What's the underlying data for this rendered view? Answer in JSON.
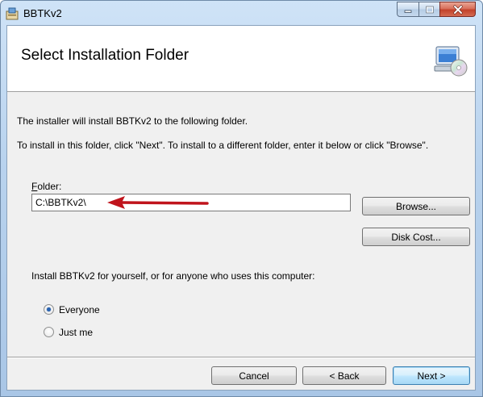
{
  "window": {
    "title": "BBTKv2",
    "controls": {
      "minimize": "minimize",
      "maximize": "maximize",
      "close": "close"
    }
  },
  "banner": {
    "title": "Select Installation Folder",
    "icon": "computer-cd-icon"
  },
  "body": {
    "line1": "The installer will install BBTKv2 to the following folder.",
    "line2": "To install in this folder, click \"Next\". To install to a different folder, enter it below or click \"Browse\"."
  },
  "folder": {
    "label_underlined": "F",
    "label_rest": "older:",
    "value": "C:\\BBTKv2\\"
  },
  "buttons": {
    "browse": "Browse...",
    "disk_cost": "Disk Cost...",
    "cancel": "Cancel",
    "back": "< Back",
    "next": "Next >"
  },
  "install_for": {
    "prompt": "Install BBTKv2 for yourself, or for anyone who uses this computer:",
    "options": [
      {
        "label": "Everyone",
        "selected": true
      },
      {
        "label": "Just me",
        "selected": false
      }
    ]
  },
  "colors": {
    "arrow": "#c0141c",
    "next_accent": "#3c7fb1"
  }
}
